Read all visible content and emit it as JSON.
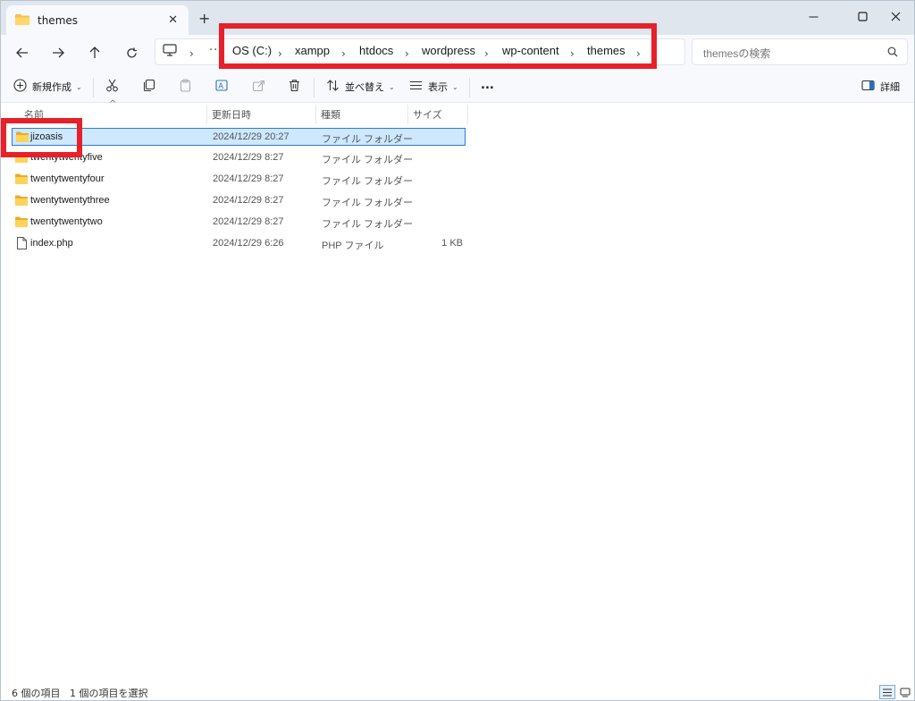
{
  "window": {
    "tab_title": "themes",
    "new_tab_symbol": "+",
    "close_symbol": "✕"
  },
  "breadcrumb": [
    "OS (C:)",
    "xampp",
    "htdocs",
    "wordpress",
    "wp-content",
    "themes"
  ],
  "search": {
    "placeholder": "themesの検索"
  },
  "command_bar": {
    "new_label": "新規作成",
    "sort_label": "並べ替え",
    "view_label": "表示",
    "more_label": "...",
    "details_label": "詳細"
  },
  "columns": {
    "name": "名前",
    "modified": "更新日時",
    "type": "種類",
    "size": "サイズ"
  },
  "files": [
    {
      "name": "jizoasis",
      "modified": "2024/12/29 20:27",
      "type": "ファイル フォルダー",
      "size": "",
      "icon": "folder-icon",
      "selected": true
    },
    {
      "name": "twentytwentyfive",
      "modified": "2024/12/29 8:27",
      "type": "ファイル フォルダー",
      "size": "",
      "icon": "folder-icon",
      "selected": false
    },
    {
      "name": "twentytwentyfour",
      "modified": "2024/12/29 8:27",
      "type": "ファイル フォルダー",
      "size": "",
      "icon": "folder-icon",
      "selected": false
    },
    {
      "name": "twentytwentythree",
      "modified": "2024/12/29 8:27",
      "type": "ファイル フォルダー",
      "size": "",
      "icon": "folder-icon",
      "selected": false
    },
    {
      "name": "twentytwentytwo",
      "modified": "2024/12/29 8:27",
      "type": "ファイル フォルダー",
      "size": "",
      "icon": "folder-icon",
      "selected": false
    },
    {
      "name": "index.php",
      "modified": "2024/12/29 6:26",
      "type": "PHP ファイル",
      "size": "1 KB",
      "icon": "file-icon",
      "selected": false
    }
  ],
  "status": {
    "item_count": "6 個の項目",
    "selected_count": "1 個の項目を選択"
  },
  "colors": {
    "accent": "#2d7ad6",
    "selection": "#cde8ff",
    "highlight_box": "#e8202a",
    "folder": "#f5c24a"
  }
}
